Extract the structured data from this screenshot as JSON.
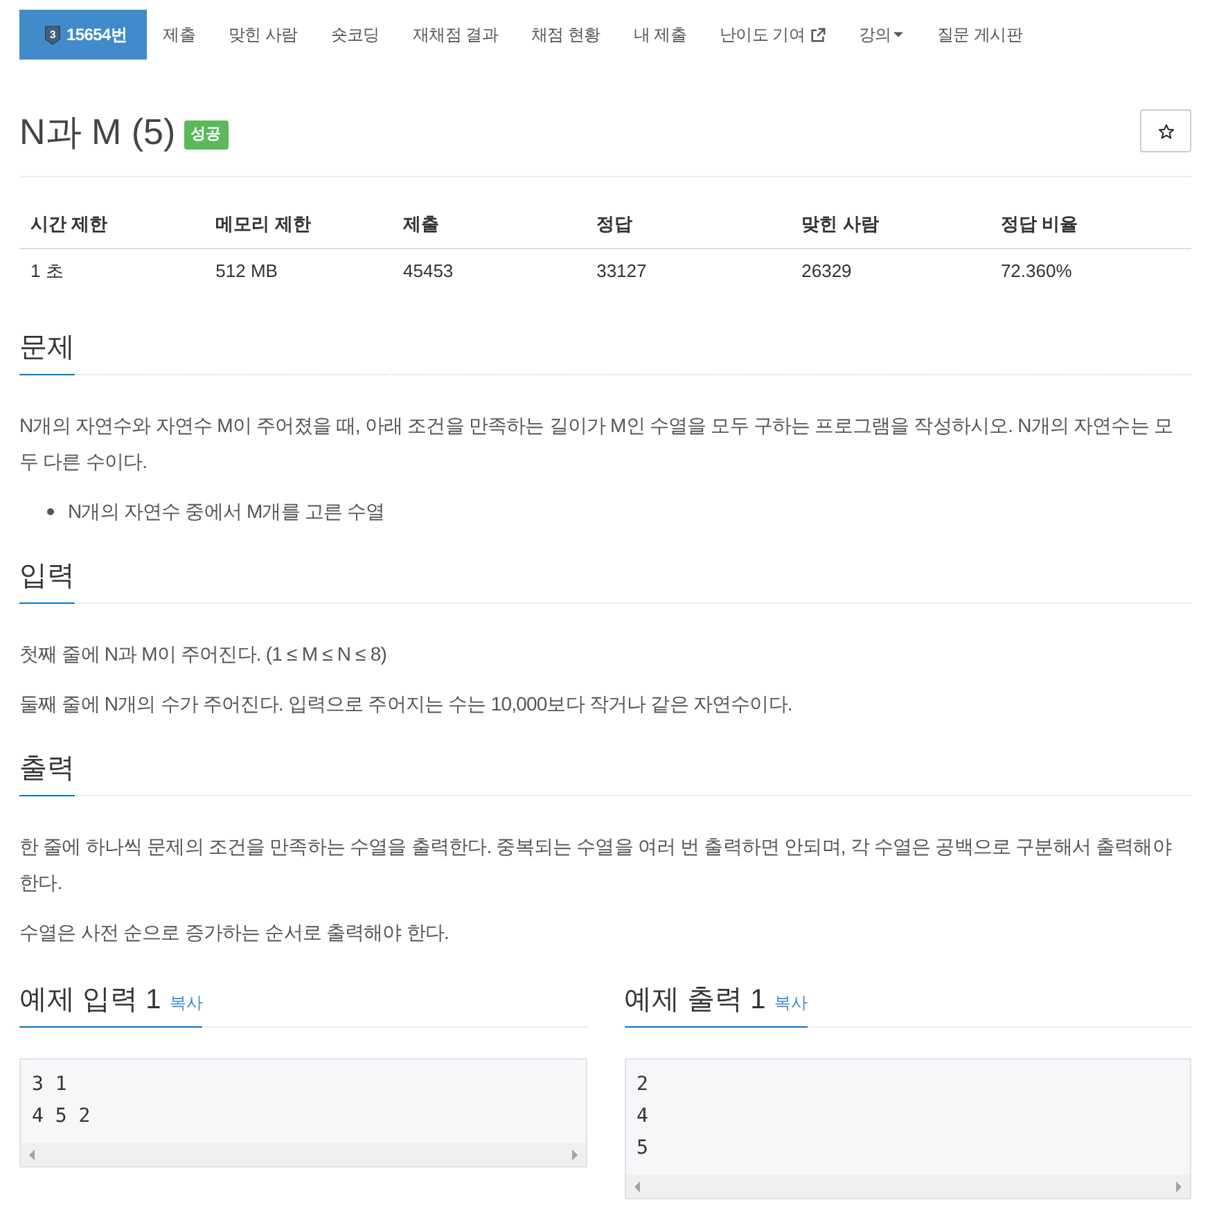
{
  "nav": {
    "items": [
      {
        "kind": "problem",
        "tier": "3",
        "label": "15654번",
        "selected": true
      },
      {
        "kind": "link",
        "label": "제출",
        "selected": false
      },
      {
        "kind": "link",
        "label": "맞힌 사람",
        "selected": false
      },
      {
        "kind": "link",
        "label": "숏코딩",
        "selected": false
      },
      {
        "kind": "link",
        "label": "재채점 결과",
        "selected": false
      },
      {
        "kind": "link",
        "label": "채점 현황",
        "selected": false
      },
      {
        "kind": "link",
        "label": "내 제출",
        "selected": false
      },
      {
        "kind": "external",
        "label": "난이도 기여",
        "selected": false
      },
      {
        "kind": "dropdown",
        "label": "강의",
        "selected": false
      },
      {
        "kind": "link",
        "label": "질문 게시판",
        "selected": false
      }
    ]
  },
  "problem": {
    "title": "N과 M (5)",
    "result_badge": "성공"
  },
  "info_table": {
    "columns": [
      "시간 제한",
      "메모리 제한",
      "제출",
      "정답",
      "맞힌 사람",
      "정답 비율"
    ],
    "rows": [
      [
        "1 초",
        "512 MB",
        "45453",
        "33127",
        "26329",
        "72.360%"
      ]
    ]
  },
  "sections": [
    {
      "title": "문제",
      "blocks": [
        {
          "kind": "paragraph",
          "text": "N개의 자연수와 자연수 M이 주어졌을 때, 아래 조건을 만족하는 길이가 M인 수열을 모두 구하는 프로그램을 작성하시오. N개의 자연수는 모두 다른 수이다."
        },
        {
          "kind": "list",
          "items": [
            "N개의 자연수 중에서 M개를 고른 수열"
          ]
        }
      ]
    },
    {
      "title": "입력",
      "blocks": [
        {
          "kind": "paragraph",
          "text": "첫째 줄에 N과 M이 주어진다. (1 ≤ M ≤ N ≤ 8)"
        },
        {
          "kind": "paragraph",
          "text": "둘째 줄에 N개의 수가 주어진다. 입력으로 주어지는 수는 10,000보다 작거나 같은 자연수이다."
        }
      ]
    },
    {
      "title": "출력",
      "blocks": [
        {
          "kind": "paragraph",
          "text": "한 줄에 하나씩 문제의 조건을 만족하는 수열을 출력한다. 중복되는 수열을 여러 번 출력하면 안되며, 각 수열은 공백으로 구분해서 출력해야 한다."
        },
        {
          "kind": "paragraph",
          "text": "수열은 사전 순으로 증가하는 순서로 출력해야 한다."
        }
      ]
    }
  ],
  "samples": [
    {
      "title": "예제 입력 1",
      "copy_label": "복사",
      "lines": [
        "3 1",
        "4 5 2"
      ]
    },
    {
      "title": "예제 출력 1",
      "copy_label": "복사",
      "lines": [
        "2",
        "4",
        "5"
      ]
    }
  ]
}
